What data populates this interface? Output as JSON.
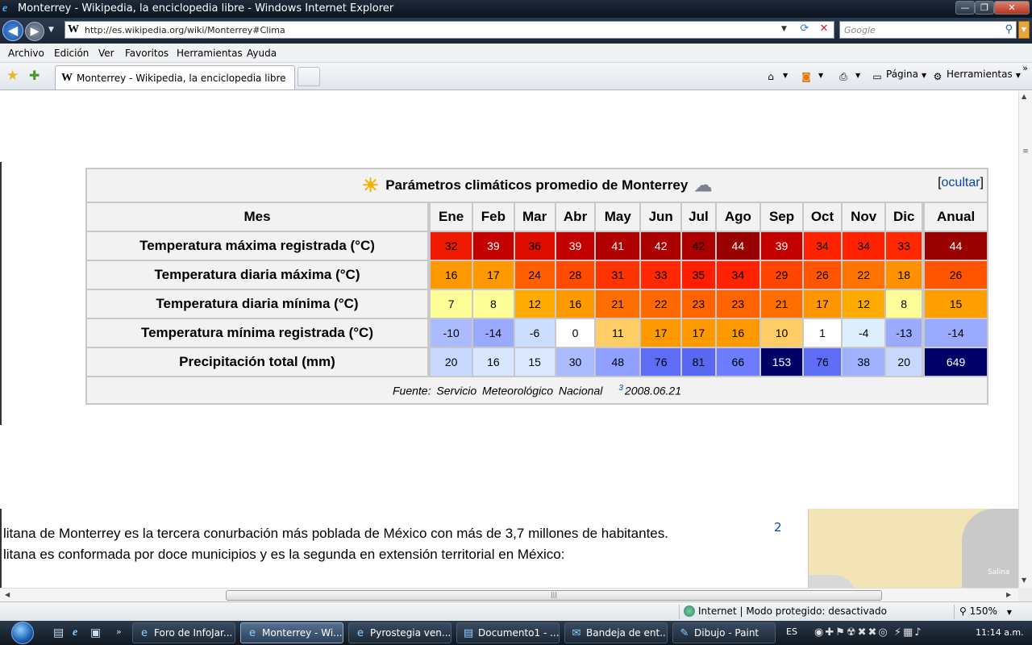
{
  "window": {
    "title": "Monterrey - Wikipedia, la enciclopedia libre - Windows Internet Explorer",
    "min": "—",
    "max": "❐",
    "close": "✕"
  },
  "nav": {
    "url": "http://es.wikipedia.org/wiki/Monterrey#Clima",
    "search_placeholder": "Google"
  },
  "menu": [
    "Archivo",
    "Edición",
    "Ver",
    "Favoritos",
    "Herramientas",
    "Ayuda"
  ],
  "tab": {
    "label": "Monterrey - Wikipedia, la enciclopedia libre"
  },
  "commands": {
    "page": "Página",
    "tools": "Herramientas"
  },
  "climate": {
    "caption": "Parámetros climáticos promedio de Monterrey",
    "hide_label": "ocultar",
    "header_label": "Mes",
    "months": [
      "Ene",
      "Feb",
      "Mar",
      "Abr",
      "May",
      "Jun",
      "Jul",
      "Ago",
      "Sep",
      "Oct",
      "Nov",
      "Dic"
    ],
    "annual_label": "Anual",
    "rows": [
      {
        "label": "Temperatura máxima registrada (°C)",
        "values": [
          "32",
          "39",
          "36",
          "39",
          "41",
          "42",
          "42",
          "44",
          "39",
          "34",
          "34",
          "33"
        ],
        "annual": "44",
        "colors": [
          "#ee1a00",
          "#c20000",
          "#dd0d00",
          "#c20000",
          "#b20000",
          "#aa0000",
          "#aa0000",
          "#990000",
          "#c20000",
          "#ff2200",
          "#ff2200",
          "#ff2800"
        ],
        "annual_color": "#990000",
        "text_colors": [
          "#000",
          "#fff",
          "#000",
          "#fff",
          "#fff",
          "#fff",
          "#000",
          "#fff",
          "#fff",
          "#000",
          "#000",
          "#000"
        ],
        "annual_text": "#fff"
      },
      {
        "label": "Temperatura diaria máxima (°C)",
        "values": [
          "16",
          "17",
          "24",
          "28",
          "31",
          "33",
          "35",
          "34",
          "29",
          "26",
          "22",
          "18"
        ],
        "annual": "26",
        "colors": [
          "#ff9900",
          "#ff9900",
          "#ff5f00",
          "#ff4a00",
          "#ff3300",
          "#ff2800",
          "#ff1e00",
          "#ff2200",
          "#ff4400",
          "#ff5500",
          "#ff7400",
          "#ff9000"
        ],
        "annual_color": "#ff5500",
        "text_colors": [
          "#000",
          "#000",
          "#000",
          "#000",
          "#000",
          "#000",
          "#000",
          "#000",
          "#000",
          "#000",
          "#000",
          "#000"
        ],
        "annual_text": "#000"
      },
      {
        "label": "Temperatura diaria mínima (°C)",
        "values": [
          "7",
          "8",
          "12",
          "16",
          "21",
          "22",
          "23",
          "23",
          "21",
          "17",
          "12",
          "8"
        ],
        "annual": "15",
        "colors": [
          "#ffff99",
          "#ffff99",
          "#ffaa00",
          "#ff9900",
          "#ff6f00",
          "#ff6a00",
          "#ff6400",
          "#ff6400",
          "#ff6f00",
          "#ff9500",
          "#ffaa00",
          "#ffff99"
        ],
        "annual_color": "#ffa000",
        "text_colors": [
          "#000",
          "#000",
          "#000",
          "#000",
          "#000",
          "#000",
          "#000",
          "#000",
          "#000",
          "#000",
          "#000",
          "#000"
        ],
        "annual_text": "#000"
      },
      {
        "label": "Temperatura mínima registrada (°C)",
        "values": [
          "-10",
          "-14",
          "-6",
          "0",
          "11",
          "17",
          "17",
          "16",
          "10",
          "1",
          "-4",
          "-13"
        ],
        "annual": "-14",
        "colors": [
          "#aabbff",
          "#99aaff",
          "#ccddff",
          "#ffffff",
          "#ffcc66",
          "#ff9900",
          "#ff9900",
          "#ff9900",
          "#ffcc66",
          "#ffffff",
          "#ddeeff",
          "#99aaff"
        ],
        "annual_color": "#99aaff",
        "text_colors": [
          "#000",
          "#000",
          "#000",
          "#000",
          "#000",
          "#000",
          "#000",
          "#000",
          "#000",
          "#000",
          "#000",
          "#000"
        ],
        "annual_text": "#000"
      },
      {
        "label": "Precipitación total (mm)",
        "values": [
          "20",
          "16",
          "15",
          "30",
          "48",
          "76",
          "81",
          "66",
          "153",
          "76",
          "38",
          "20"
        ],
        "annual": "649",
        "colors": [
          "#c8d8ff",
          "#d8e6ff",
          "#dbe8ff",
          "#aabbff",
          "#8f9fff",
          "#5d6df6",
          "#5868f0",
          "#6d7cff",
          "#000066",
          "#5d6df6",
          "#a0b0ff",
          "#c8d8ff"
        ],
        "annual_color": "#000066",
        "text_colors": [
          "#000",
          "#000",
          "#000",
          "#000",
          "#000",
          "#000",
          "#000",
          "#000",
          "#fff",
          "#000",
          "#000",
          "#000"
        ],
        "annual_text": "#fff"
      }
    ],
    "source_prefix": "Fuente: Servicio Meteorológico Nacional",
    "source_ref": "3",
    "source_date": "2008.06.21"
  },
  "article": {
    "line1": "litana de Monterrey es la tercera conurbación más poblada de México con más de 3,7 millones de habitantes.",
    "line2": "litana es conformada por doce municipios y es la segunda en extensión territorial en México:",
    "ref": "2",
    "map_label": "Salina"
  },
  "status": {
    "zone": "Internet | Modo protegido: desactivado",
    "zoom": "150%"
  },
  "taskbar": {
    "items": [
      {
        "label": "Foro de InfoJar...",
        "icon": "e",
        "active": false
      },
      {
        "label": "Monterrey - Wi...",
        "icon": "e",
        "active": true
      },
      {
        "label": "Pyrostegia ven...",
        "icon": "e",
        "active": false
      },
      {
        "label": "Documento1 - ...",
        "icon": "▤",
        "active": false
      },
      {
        "label": "Bandeja de ent...",
        "icon": "✉",
        "active": false
      },
      {
        "label": "Dibujo - Paint",
        "icon": "✎",
        "active": false
      }
    ],
    "language": "ES",
    "clock": "11:14 a.m."
  }
}
